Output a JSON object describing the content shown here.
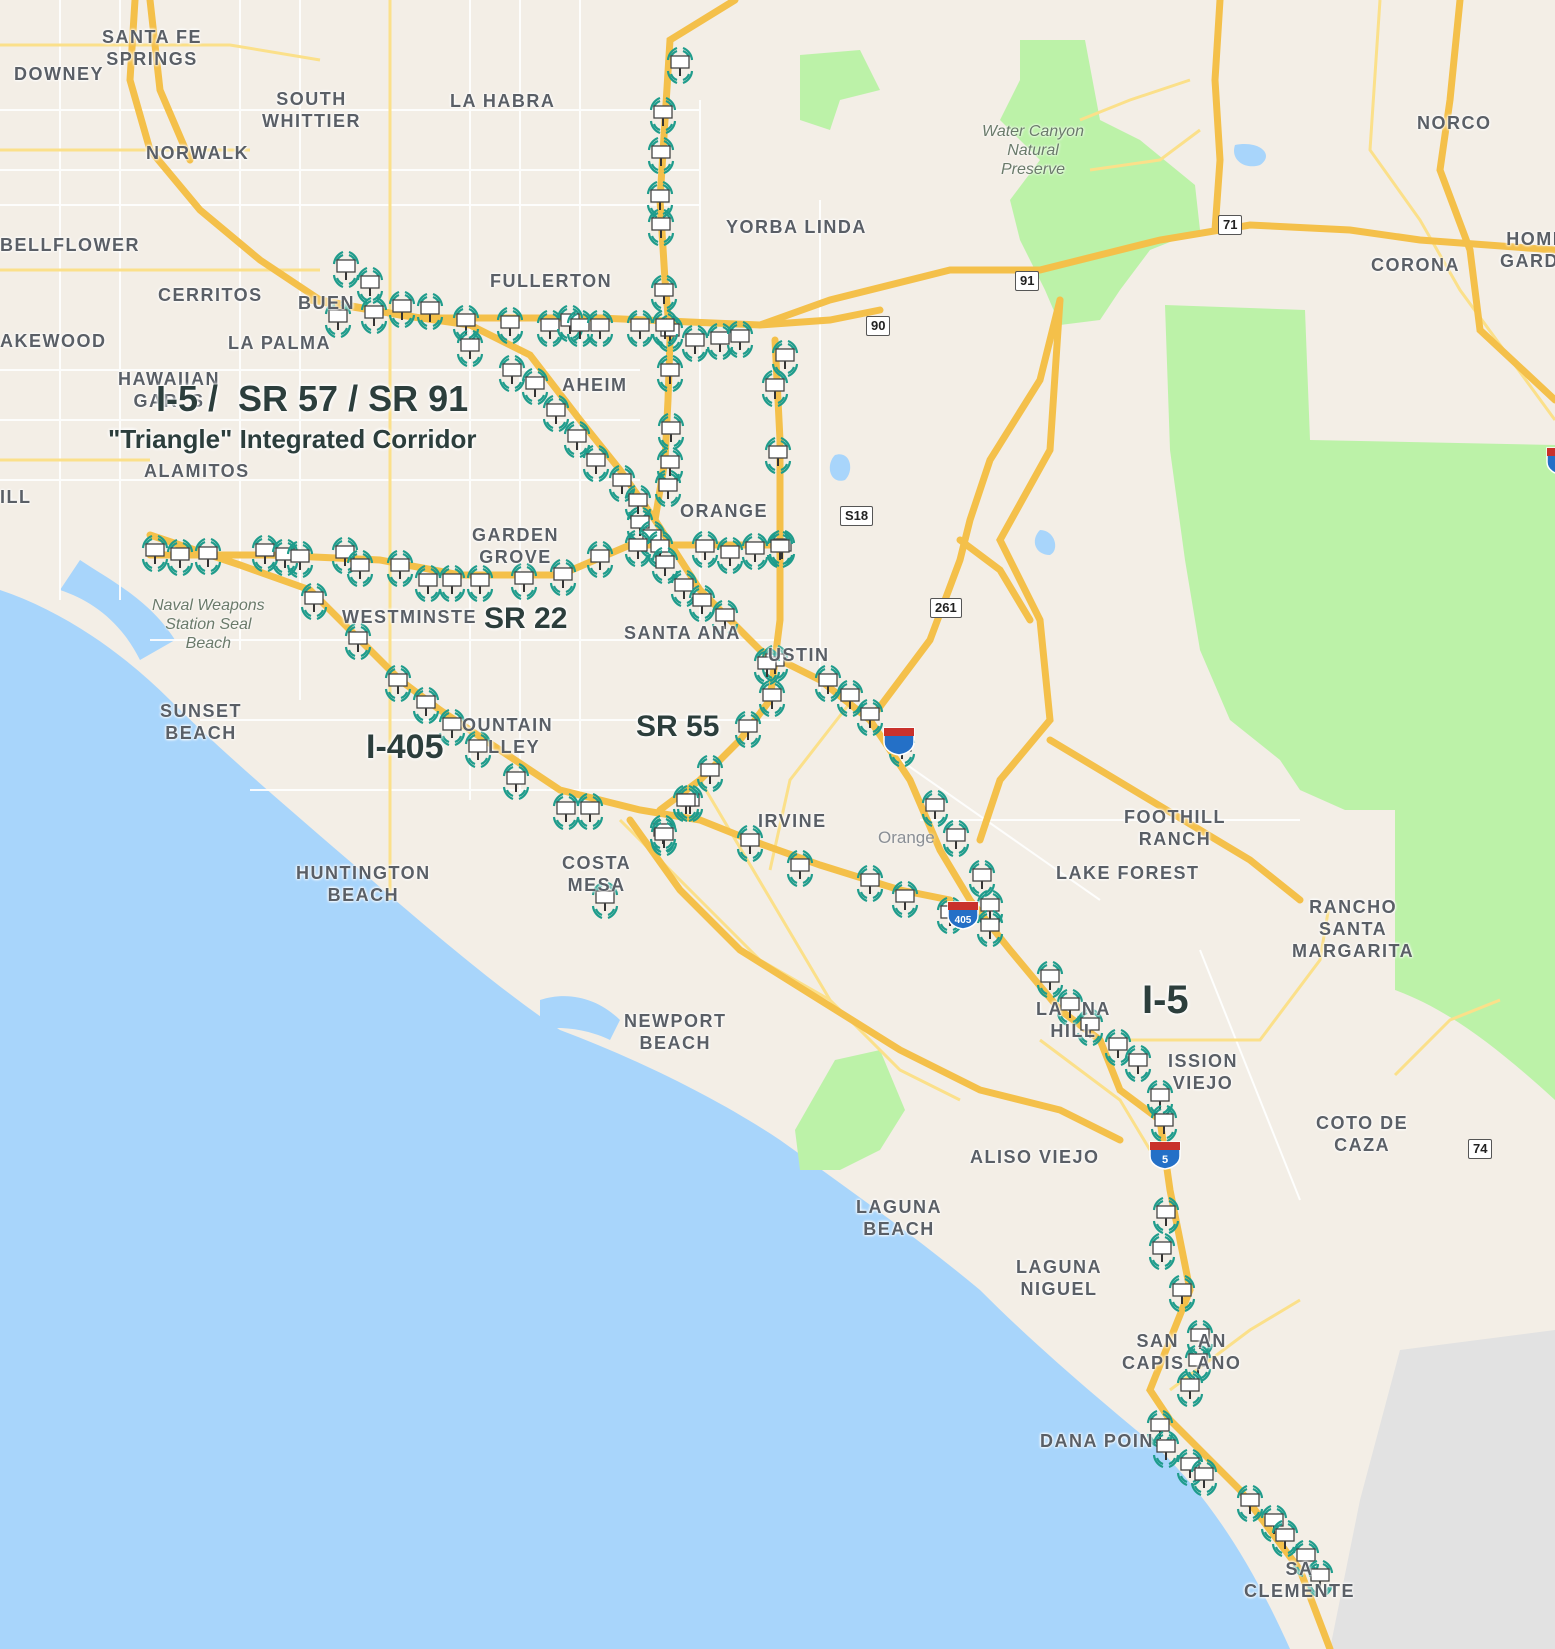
{
  "map": {
    "colors": {
      "land": "#f3eee6",
      "water": "#a8d5fb",
      "park": "#bcf2a8",
      "freeway": "#f4c04a",
      "road": "#ffffff",
      "sensor": "#1f9c8c"
    },
    "corridors": {
      "triangle_line1": "I-5 /  SR 57 / SR 91",
      "triangle_line2": "\"Triangle\" Integrated Corridor",
      "sr22": "SR 22",
      "sr55": "SR 55",
      "i405": "I-405",
      "i5": "I-5"
    },
    "places": {
      "santa_fe_springs": "SANTA FE\nSPRINGS",
      "downey": "DOWNEY",
      "south_whittier": "SOUTH\nWHITTIER",
      "la_habra": "LA HABRA",
      "norwalk": "NORWALK",
      "norco": "NORCO",
      "bellflower": "BELLFLOWER",
      "yorba_linda": "YORBA LINDA",
      "cerritos": "CERRITOS",
      "fullerton": "FULLERTON",
      "buena": "BUEN",
      "corona": "CORONA",
      "home_gardens": "HOME\nGARDE",
      "lakewood": "AKEWOOD",
      "la_palma": "LA PALMA",
      "hawaiian_gardens": "HAWAIIAN\nGAR  S",
      "anaheim": "AHEIM",
      "los_alamitos": "ALAMITOS",
      "hill": "ILL",
      "garden_grove": "GARDEN\nGROVE",
      "orange": "ORANGE",
      "westminster": "WESTMINSTE",
      "santa_ana": "SANTA ANA",
      "tustin": "USTIN",
      "sunset_beach": "SUNSET\nBEACH",
      "fountain_valley": "OUNTAIN\n  LLEY",
      "irvine": "IRVINE",
      "foothill_ranch": "FOOTHILL\nRANCH",
      "huntington_beach": "HUNTINGTON\nBEACH",
      "costa_mesa": "COSTA\nMESA",
      "lake_forest": "LAKE FOREST",
      "rancho_santa_margarita": "RANCHO\nSANTA\nMARGARITA",
      "laguna_hills": "LA   NA\nHILL",
      "mission_viejo": "ISSION\nVIEJO",
      "newport_beach": "NEWPORT\nBEACH",
      "coto_de_caza": "COTO DE\nCAZA",
      "aliso_viejo": "ALISO VIEJO",
      "laguna_beach": "LAGUNA\nBEACH",
      "laguna_niguel": "LAGUNA\nNIGUEL",
      "san_juan_capistrano": "SAN   AN\nCAPIS  ANO",
      "dana_point": "DANA POIN",
      "san_clemente": "SA\nCLEMENTE",
      "orange_county_small": "Orange"
    },
    "parks": {
      "water_canyon": "Water Canyon\nNatural\nPreserve",
      "naval_weapons": "Naval Weapons\nStation Seal\nBeach"
    },
    "shields": {
      "sr71": "71",
      "sr91": "91",
      "sr90": "90",
      "s18": "S18",
      "sr261": "261",
      "sr74": "74",
      "i5_shield": "5",
      "i405_shield": "405"
    }
  }
}
